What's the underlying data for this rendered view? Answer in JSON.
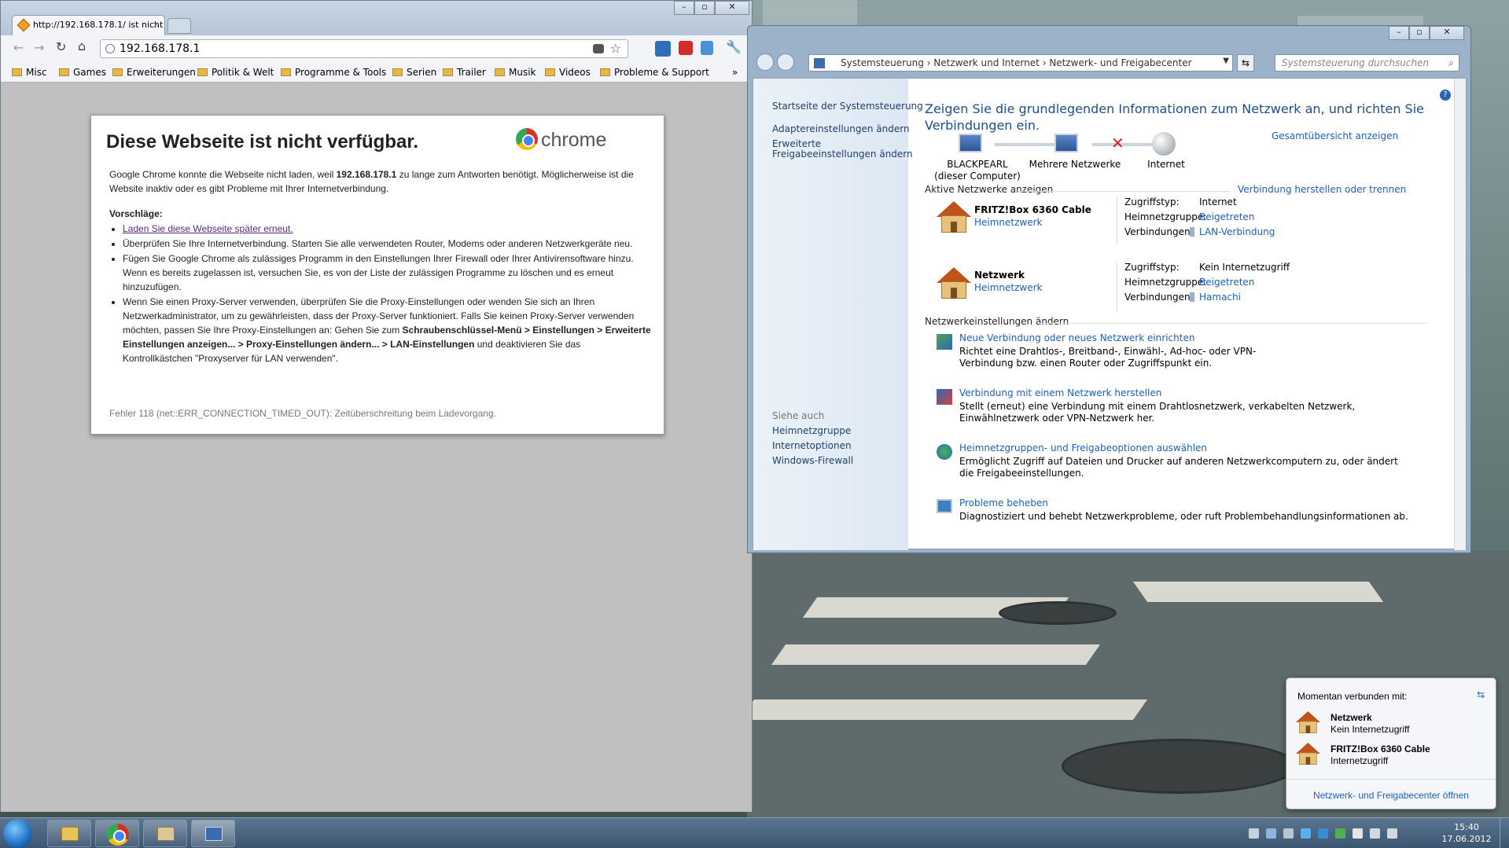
{
  "chrome": {
    "tab_title": "http://192.168.178.1/ ist nicht",
    "url": "192.168.178.1",
    "window_controls": [
      "–",
      "▫",
      "✕"
    ],
    "bookmarks": [
      "Misc",
      "Games",
      "Erweiterungen",
      "Politik & Welt",
      "Programme & Tools",
      "Serien",
      "Trailer",
      "Musik",
      "Videos",
      "Probleme & Support"
    ],
    "overflow": "»",
    "error": {
      "title": "Diese Webseite ist nicht verfügbar.",
      "logo_text": "chrome",
      "intro_1": "Google Chrome konnte die Webseite nicht laden, weil ",
      "intro_host": "192.168.178.1",
      "intro_2": " zu lange zum Antworten benötigt. Möglicherweise ist die Website inaktiv oder es gibt Probleme mit Ihrer Internetverbindung.",
      "suggestions_heading": "Vorschläge:",
      "reload_link": "Laden Sie diese Webseite später erneut.",
      "suggestion_2": "Überprüfen Sie Ihre Internetverbindung. Starten Sie alle verwendeten Router, Modems oder anderen Netzwerkgeräte neu.",
      "suggestion_3": "Fügen Sie Google Chrome als zulässiges Programm in den Einstellungen Ihrer Firewall oder Ihrer Antivirensoftware hinzu. Wenn es bereits zugelassen ist, versuchen Sie, es von der Liste der zulässigen Programme zu löschen und es erneut hinzuzufügen.",
      "suggestion_4a": "Wenn Sie einen Proxy-Server verwenden, überprüfen Sie die Proxy-Einstellungen oder wenden Sie sich an Ihren Netzwerkadministrator, um zu gewährleisten, dass der Proxy-Server funktioniert. Falls Sie keinen Proxy-Server verwenden möchten, passen Sie Ihre Proxy-Einstellungen an: Gehen Sie zum ",
      "suggestion_4b": "Schraubenschlüssel-Menü > Einstellungen > Erweiterte Einstellungen anzeigen... > Proxy-Einstellungen ändern... > LAN-Einstellungen",
      "suggestion_4c": " und deaktivieren Sie das Kontrollkästchen \"Proxyserver für LAN verwenden\".",
      "error_code": "Fehler 118 (net::ERR_CONNECTION_TIMED_OUT): Zeitüberschreitung beim Ladevorgang."
    }
  },
  "control_panel": {
    "breadcrumb": [
      "Systemsteuerung",
      "Netzwerk und Internet",
      "Netzwerk- und Freigabecenter"
    ],
    "search_placeholder": "Systemsteuerung durchsuchen",
    "left": {
      "home": "Startseite der Systemsteuerung",
      "adapter": "Adaptereinstellungen ändern",
      "sharing_1": "Erweiterte",
      "sharing_2": "Freigabeeinstellungen ändern",
      "see_also": "Siehe auch",
      "homegroup": "Heimnetzgruppe",
      "internet_options": "Internetoptionen",
      "firewall": "Windows-Firewall"
    },
    "main": {
      "heading": "Zeigen Sie die grundlegenden Informationen zum Netzwerk an, und richten Sie Verbindungen ein.",
      "full_map": "Gesamtübersicht anzeigen",
      "node_pc": "BLACKPEARL",
      "node_pc_sub": "(dieser Computer)",
      "node_multi": "Mehrere Netzwerke",
      "node_internet": "Internet",
      "active_networks": "Aktive Netzwerke anzeigen",
      "connect_disconnect": "Verbindung herstellen oder trennen",
      "networks": [
        {
          "name": "FRITZ!Box 6360 Cable",
          "type": "Heimnetzwerk",
          "access_label": "Zugriffstyp:",
          "access": "Internet",
          "homegroup_label": "Heimnetzgruppe:",
          "homegroup": "Beigetreten",
          "conn_label": "Verbindungen:",
          "conn": "LAN-Verbindung"
        },
        {
          "name": "Netzwerk",
          "type": "Heimnetzwerk",
          "access_label": "Zugriffstyp:",
          "access": "Kein Internetzugriff",
          "homegroup_label": "Heimnetzgruppe:",
          "homegroup": "Beigetreten",
          "conn_label": "Verbindungen:",
          "conn": "Hamachi"
        }
      ],
      "change_settings": "Netzwerkeinstellungen ändern",
      "tasks": [
        {
          "title": "Neue Verbindung oder neues Netzwerk einrichten",
          "desc": "Richtet eine Drahtlos-, Breitband-, Einwähl-, Ad-hoc- oder VPN-Verbindung bzw. einen Router oder Zugriffspunkt ein."
        },
        {
          "title": "Verbindung mit einem Netzwerk herstellen",
          "desc": "Stellt (erneut) eine Verbindung mit einem Drahtlosnetzwerk, verkabelten Netzwerk, Einwählnetzwerk oder VPN-Netzwerk her."
        },
        {
          "title": "Heimnetzgruppen- und Freigabeoptionen auswählen",
          "desc": "Ermöglicht Zugriff auf Dateien und Drucker auf anderen Netzwerkcomputern zu, oder ändert die Freigabeeinstellungen."
        },
        {
          "title": "Probleme beheben",
          "desc": "Diagnostiziert und behebt Netzwerkprobleme, oder ruft Problembehandlungsinformationen ab."
        }
      ]
    }
  },
  "popup": {
    "heading": "Momentan verbunden mit:",
    "items": [
      {
        "name": "Netzwerk",
        "status": "Kein Internetzugriff"
      },
      {
        "name": "FRITZ!Box 6360 Cable",
        "status": "Internetzugriff"
      }
    ],
    "open_center": "Netzwerk- und Freigabecenter öffnen"
  },
  "taskbar": {
    "time": "15:40",
    "date": "17.06.2012"
  }
}
